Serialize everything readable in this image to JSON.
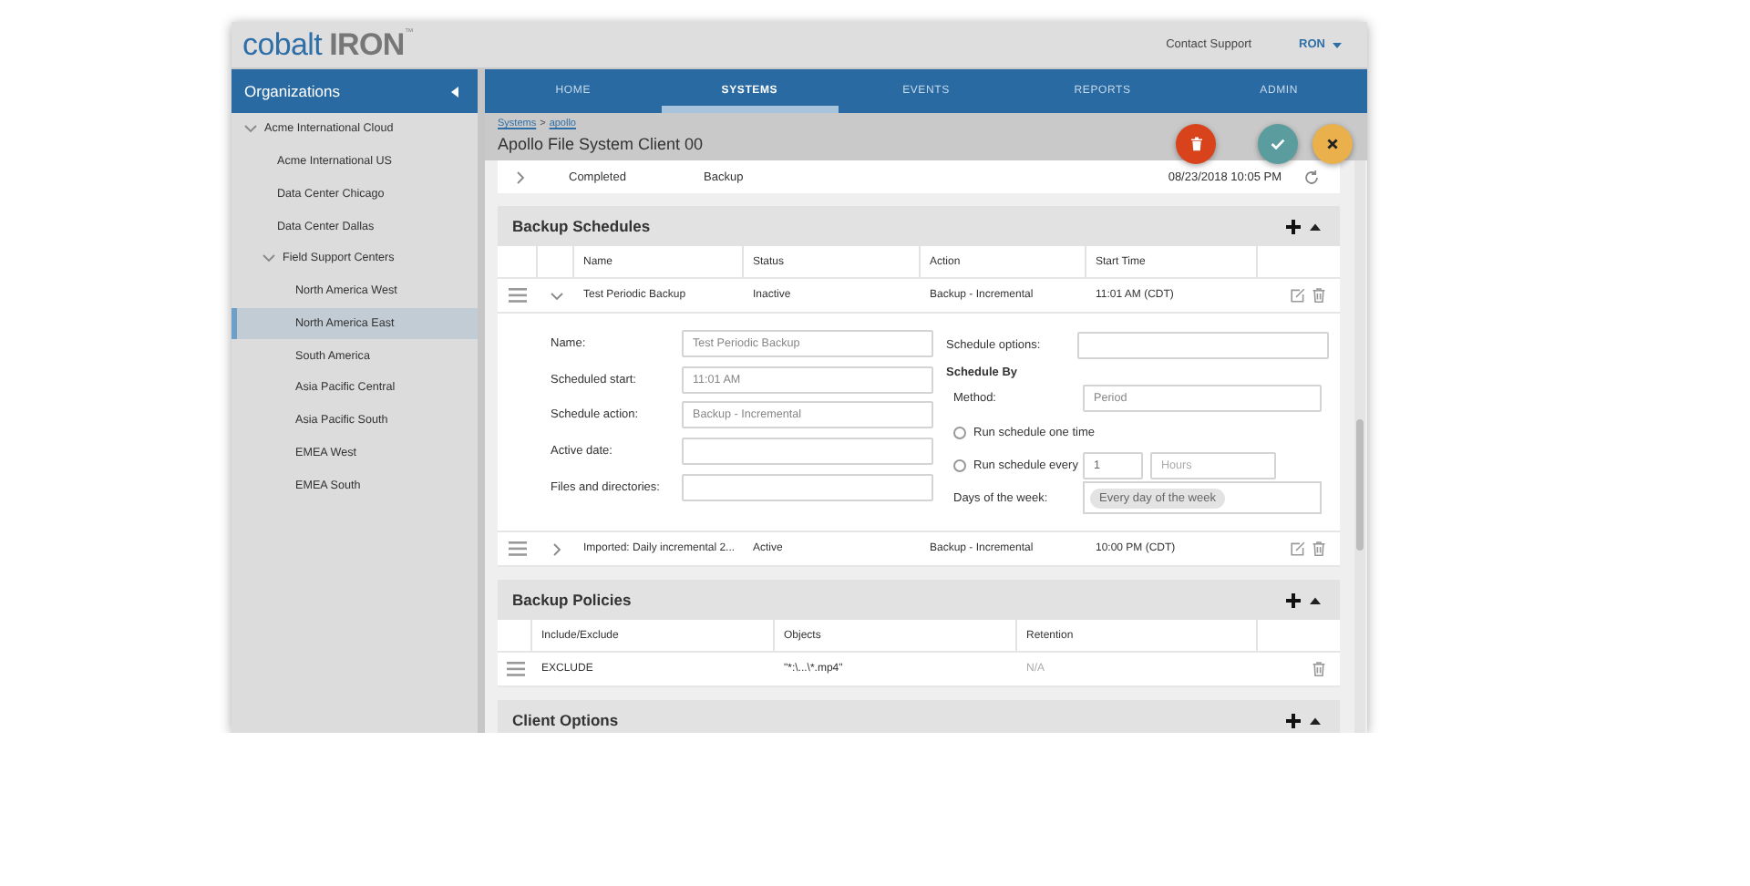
{
  "header": {
    "logo": {
      "word": "cobalt",
      "strong": "IRON",
      "mark": "™"
    },
    "support_link": "Contact Support",
    "user": "RON"
  },
  "sidebar": {
    "title": "Organizations",
    "items": [
      {
        "label": "Acme International Cloud",
        "expanded": true,
        "selected": false,
        "children": [
          {
            "label": "Acme International US",
            "selected": false
          },
          {
            "label": "Data Center Chicago",
            "selected": false
          },
          {
            "label": "Data Center Dallas",
            "selected": false
          },
          {
            "label": "Field Support Centers",
            "expanded": true,
            "selected": false,
            "children": [
              {
                "label": "North America West",
                "selected": false
              },
              {
                "label": "North America East",
                "selected": true
              },
              {
                "label": "South America",
                "selected": false
              },
              {
                "label": "Asia Pacific Central",
                "selected": false
              },
              {
                "label": "Asia Pacific South",
                "selected": false
              },
              {
                "label": "EMEA West",
                "selected": false
              },
              {
                "label": "EMEA South",
                "selected": false
              }
            ]
          }
        ]
      }
    ]
  },
  "nav": {
    "tabs": [
      {
        "label": "HOME",
        "selected": false
      },
      {
        "label": "SYSTEMS",
        "selected": true
      },
      {
        "label": "EVENTS",
        "selected": false
      },
      {
        "label": "REPORTS",
        "selected": false
      },
      {
        "label": "ADMIN",
        "selected": false
      }
    ]
  },
  "breadcrumb": {
    "items": [
      "Systems",
      "apollo"
    ],
    "separator": ">"
  },
  "page_title": "Apollo File System Client 00",
  "actions": [
    {
      "kind": "delete"
    },
    {
      "kind": "confirm"
    },
    {
      "kind": "cancel"
    }
  ],
  "history_row": {
    "expanded": false,
    "status": "Completed",
    "type": "Backup",
    "time": "08/23/2018 10:05 PM"
  },
  "schedules": {
    "title": "Backup Schedules",
    "columns": [
      "Name",
      "Status",
      "Action",
      "Start Time"
    ],
    "rows": [
      {
        "expanded": true,
        "name": "Test Periodic Backup",
        "status": "Inactive",
        "action": "Backup - Incremental",
        "start_time": "11:01 AM (CDT)"
      },
      {
        "expanded": false,
        "name": "Imported: Daily incremental 2...",
        "status": "Active",
        "action": "Backup - Incremental",
        "start_time": "10:00 PM (CDT)"
      }
    ],
    "detail": {
      "fields": [
        {
          "label": "Name:",
          "value": "Test Periodic Backup"
        },
        {
          "label": "Scheduled start:",
          "value": "11:01 AM"
        },
        {
          "label": "Schedule action:",
          "value": "Backup - Incremental"
        },
        {
          "label": "Active date:"
        },
        {
          "label": "Files and directories:"
        }
      ],
      "options": {
        "label": "Schedule options:"
      },
      "schedule_by": {
        "title": "Schedule By",
        "method": {
          "label": "Method:",
          "value": "Period"
        },
        "radios": [
          {
            "label": "Run schedule one time",
            "selected": false
          },
          {
            "label": "Run schedule every",
            "selected": false
          }
        ],
        "interval": {
          "value": "1",
          "unit_placeholder": "Hours"
        },
        "days": {
          "label": "Days of the week:",
          "chips": [
            "Every day of the week"
          ]
        }
      }
    }
  },
  "policies": {
    "title": "Backup Policies",
    "columns": [
      "Include/Exclude",
      "Objects",
      "Retention"
    ],
    "rows": [
      {
        "type": "EXCLUDE",
        "objects": "\"*:\\...\\*.mp4\"",
        "retention": "N/A"
      }
    ]
  },
  "client_options": {
    "title": "Client Options"
  }
}
